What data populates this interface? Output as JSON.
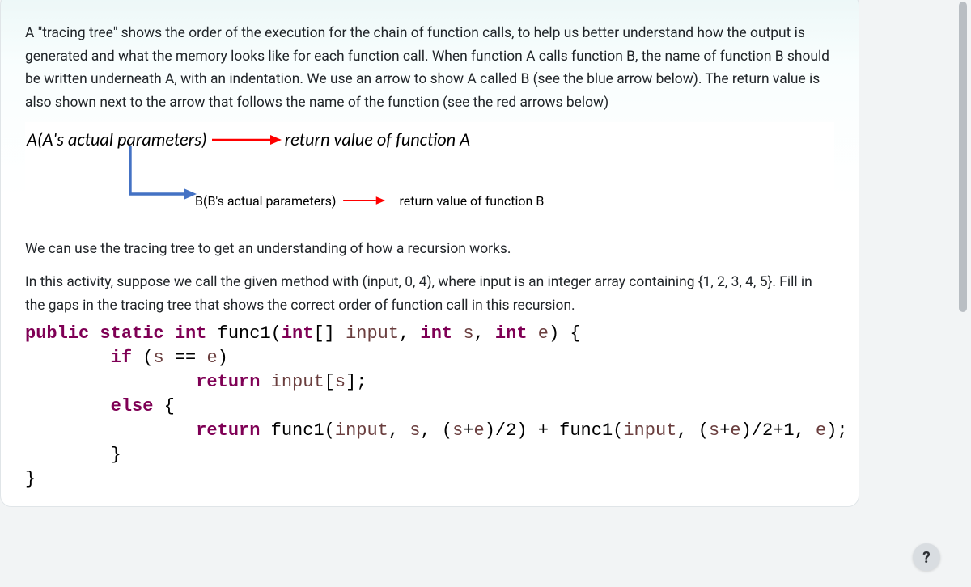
{
  "intro_paragraph": "A \"tracing tree\" shows the order of the execution for the chain of function calls, to help us better understand how the output is generated and what the memory looks like for each function call. When function A calls function B, the name of function B should be written underneath A, with an indentation. We use an arrow to show A called B (see the blue arrow below). The return value is also shown next to the arrow that follows the name of the function (see the red arrows below)",
  "diagram": {
    "a_label": "A(A's actual parameters)",
    "a_return": "return value of function A",
    "b_label": "B(B's actual parameters)",
    "b_return": "return value of function B"
  },
  "mid_paragraph": "We can use the tracing tree to get an understanding of how a recursion works.",
  "activity_paragraph": "In this activity, suppose we call the given method  with (input, 0, 4), where input is an integer array containing {1, 2, 3, 4, 5}. Fill in the gaps in the tracing tree that shows the correct order of function call in this recursion.",
  "code": {
    "sig_kw1": "public static int",
    "sig_fn": " func1(",
    "sig_kw2": "int",
    "sig_arr": "[] ",
    "sig_p1": "input",
    "sig_c1": ", ",
    "sig_kw3": "int",
    "sig_sp1": " ",
    "sig_p2": "s",
    "sig_c2": ", ",
    "sig_kw4": "int",
    "sig_sp2": " ",
    "sig_p3": "e",
    "sig_close": ") {",
    "l2_indent": "        ",
    "l2_kw": "if",
    "l2_rest": " (",
    "l2_s": "s",
    "l2_eq": " == ",
    "l2_e": "e",
    "l2_paren": ")",
    "l3_indent": "                ",
    "l3_kw": "return",
    "l3_sp": " ",
    "l3_in": "input",
    "l3_br": "[",
    "l3_s": "s",
    "l3_end": "];",
    "l4_indent": "        ",
    "l4_kw": "else",
    "l4_brace": " {",
    "l5_indent": "                ",
    "l5_kw": "return",
    "l5_rest": " func1(",
    "l5_in": "input",
    "l5_c1": ", ",
    "l5_s": "s",
    "l5_c2": ", (",
    "l5_s2": "s",
    "l5_plus": "+",
    "l5_e": "e",
    "l5_div": ")/2) + func1(",
    "l5_in2": "input",
    "l5_c3": ", (",
    "l5_s3": "s",
    "l5_plus2": "+",
    "l5_e2": "e",
    "l5_div2": ")/2+1, ",
    "l5_e3": "e",
    "l5_end": ");",
    "l6_indent": "        ",
    "l6_brace": "}",
    "l7_brace": "}"
  },
  "help_label": "?"
}
